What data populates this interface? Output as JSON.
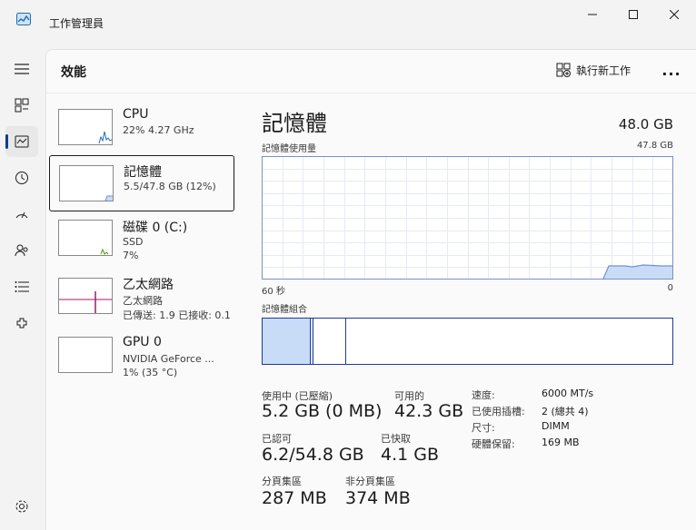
{
  "window": {
    "title": "工作管理員",
    "controls": {
      "minimize": "minimize-icon",
      "maximize": "maximize-icon",
      "close": "close-icon"
    }
  },
  "nav": {
    "items": [
      "hamburger-menu-icon",
      "processes-icon",
      "performance-icon",
      "app-history-icon",
      "startup-apps-icon",
      "users-icon",
      "details-icon",
      "services-icon",
      "settings-icon"
    ],
    "active": "performance-icon"
  },
  "header": {
    "title": "效能",
    "run_new_task": "執行新工作",
    "more": "..."
  },
  "sidebar": {
    "items": [
      {
        "title": "CPU",
        "sub1": "22%  4.27 GHz",
        "sub2": ""
      },
      {
        "title": "記憶體",
        "sub1": "5.5/47.8 GB (12%)",
        "sub2": ""
      },
      {
        "title": "磁碟 0 (C:)",
        "sub1": "SSD",
        "sub2": "7%"
      },
      {
        "title": "乙太網路",
        "sub1": "乙太網路",
        "sub2": "已傳送: 1.9  已接收: 0.1"
      },
      {
        "title": "GPU 0",
        "sub1": "NVIDIA GeForce ...",
        "sub2": "1% (35 °C)"
      }
    ],
    "selected_index": 1
  },
  "memory": {
    "title": "記憶體",
    "total": "48.0 GB",
    "usage_label": "記憶體使用量",
    "usage_max": "47.8 GB",
    "axis_left": "60 秒",
    "axis_right": "0",
    "composition_label": "記憶體組合",
    "composition": {
      "in_use_fraction": 0.115,
      "modified_fraction": 0.005,
      "standby_fraction": 0.08
    },
    "stats": {
      "in_use_label": "使用中 (已壓縮)",
      "in_use_value": "5.2 GB (0 MB)",
      "available_label": "可用的",
      "available_value": "42.3 GB",
      "committed_label": "已認可",
      "committed_value": "6.2/54.8 GB",
      "cached_label": "已快取",
      "cached_value": "4.1 GB",
      "paged_label": "分頁集區",
      "paged_value": "287 MB",
      "nonpaged_label": "非分頁集區",
      "nonpaged_value": "374 MB"
    },
    "details": [
      {
        "label": "速度:",
        "value": "6000 MT/s"
      },
      {
        "label": "已使用插槽:",
        "value": "2 (總共 4)"
      },
      {
        "label": "尺寸:",
        "value": "DIMM"
      },
      {
        "label": "硬體保留:",
        "value": "169 MB"
      }
    ]
  },
  "colors": {
    "memory_line": "#6d92d8",
    "memory_fill": "#c8dcf7",
    "cpu_line": "#1f6fb2",
    "disk_line": "#4e9a06",
    "ethernet_line": "#a1186a",
    "composition_border": "#1f3a9c"
  }
}
